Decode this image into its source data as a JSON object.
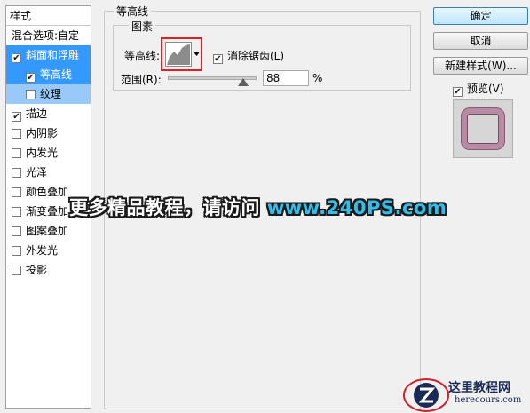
{
  "left_panel": {
    "header": "样式",
    "items": [
      {
        "label": "混合选项:自定",
        "checkbox": false,
        "checked": false,
        "state": "normal"
      },
      {
        "label": "斜面和浮雕",
        "checkbox": true,
        "checked": true,
        "state": "selected"
      },
      {
        "label": "等高线",
        "checkbox": true,
        "checked": true,
        "state": "selected",
        "indent": true
      },
      {
        "label": "纹理",
        "checkbox": true,
        "checked": false,
        "state": "highlight",
        "indent": true
      },
      {
        "label": "描边",
        "checkbox": true,
        "checked": true,
        "state": "normal"
      },
      {
        "label": "内阴影",
        "checkbox": true,
        "checked": false,
        "state": "normal"
      },
      {
        "label": "内发光",
        "checkbox": true,
        "checked": false,
        "state": "normal"
      },
      {
        "label": "光泽",
        "checkbox": true,
        "checked": false,
        "state": "normal"
      },
      {
        "label": "颜色叠加",
        "checkbox": true,
        "checked": false,
        "state": "normal"
      },
      {
        "label": "渐变叠加",
        "checkbox": true,
        "checked": false,
        "state": "normal"
      },
      {
        "label": "图案叠加",
        "checkbox": true,
        "checked": false,
        "state": "normal"
      },
      {
        "label": "外发光",
        "checkbox": true,
        "checked": false,
        "state": "normal"
      },
      {
        "label": "投影",
        "checkbox": true,
        "checked": false,
        "state": "normal"
      }
    ]
  },
  "contour_section": {
    "title": "等高线",
    "subgroup_title": "图素",
    "contour_label": "等高线:",
    "antialias_label": "消除锯齿(L)",
    "antialias_checked": true,
    "range_label": "范围(R):",
    "range_value": "88",
    "range_unit": "%"
  },
  "buttons": {
    "ok": "确定",
    "cancel": "取消",
    "new_style": "新建样式(W)...",
    "preview_label": "预览(V)",
    "preview_checked": true
  },
  "watermark": {
    "text": "更多精品教程，请访问",
    "url": "www.240PS.com"
  },
  "logo": {
    "cn": "这里教程网",
    "en": "herecours.com"
  },
  "colors": {
    "selection": "#3399ff",
    "selection_light": "#99c9f7",
    "highlight_border": "#e02020",
    "preview_ring": "#b98aa3",
    "watermark_url": "#33bde8"
  }
}
